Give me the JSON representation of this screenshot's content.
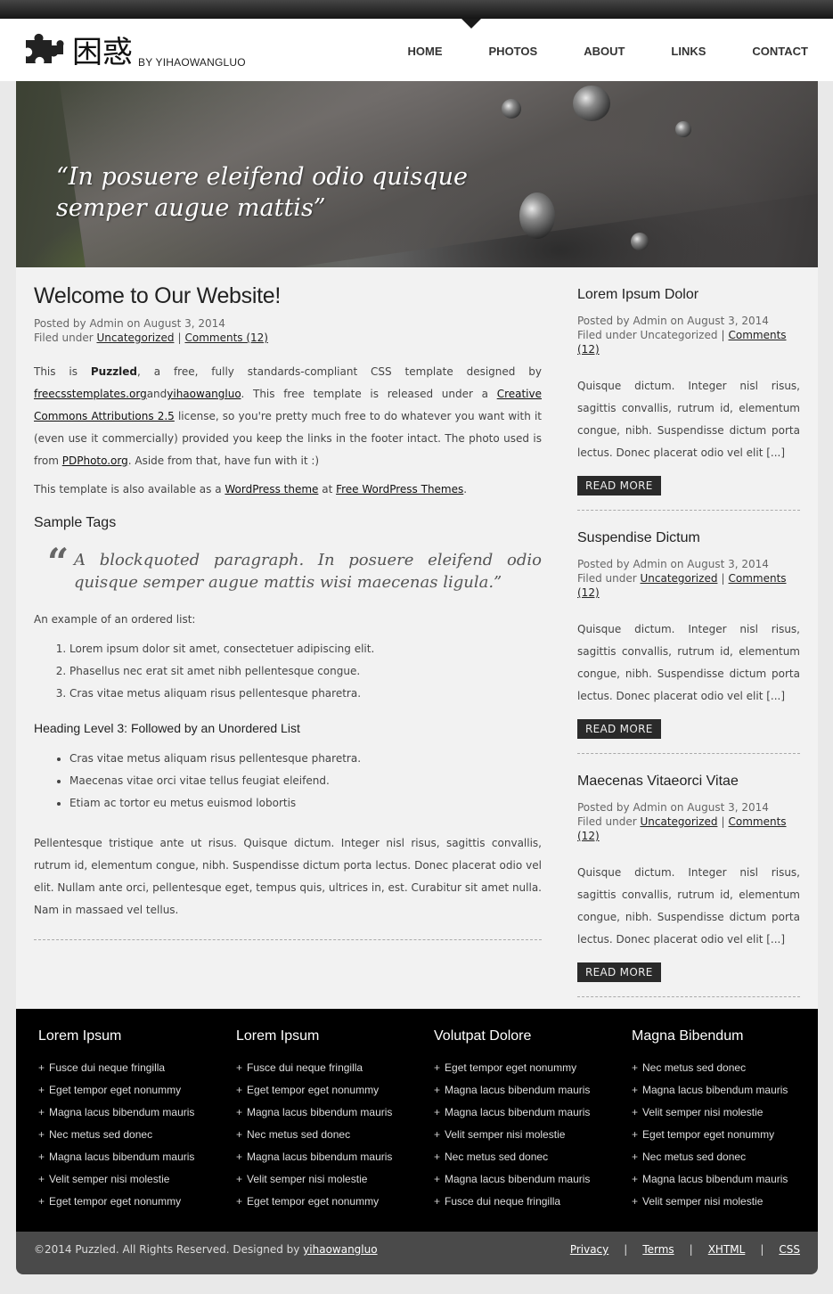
{
  "header": {
    "logo_title": "困惑",
    "logo_by": "BY YIHAOWANGLUO",
    "nav": [
      "HOME",
      "PHOTOS",
      "ABOUT",
      "LINKS",
      "CONTACT"
    ]
  },
  "hero": {
    "quote_line1": "“In posuere eleifend odio quisque",
    "quote_line2": "semper augue mattis”"
  },
  "main": {
    "title": "Welcome to Our Website!",
    "posted": "Posted by Admin on August 3, 2014",
    "filed_prefix": "Filed under ",
    "category": "Uncategorized",
    "comments": "Comments (12)",
    "intro": {
      "t1": "This is ",
      "puzzled": "Puzzled",
      "t2": ", a free, fully standards-compliant CSS template designed by ",
      "link1": "freecsstemplates.org",
      "and": "and",
      "link2": "yihaowangluo",
      "t3": ". This free template is released under a ",
      "link3": "Creative Commons Attributions 2.5",
      "t4": " license, so you're pretty much free to do whatever you want with it (even use it commercially) provided you keep the links in the footer intact. The photo used is from ",
      "link4": "PDPhoto.org",
      "t5": ". Aside from that, have fun with it :)"
    },
    "p2": {
      "t1": "This template is also available as a ",
      "link1": "WordPress theme",
      "t2": " at ",
      "link2": "Free WordPress Themes",
      "t3": "."
    },
    "sample_tags": "Sample Tags",
    "blockquote": "A blockquoted paragraph. In posuere eleifend odio quisque semper augue mattis wisi maecenas ligula.”",
    "ol_intro": "An example of an ordered list:",
    "ol": [
      "Lorem ipsum dolor sit amet, consectetuer adipiscing elit.",
      "Phasellus nec erat sit amet nibh pellentesque congue.",
      "Cras vitae metus aliquam risus pellentesque pharetra."
    ],
    "h3": "Heading Level 3: Followed by an Unordered List",
    "ul": [
      "Cras vitae metus aliquam risus pellentesque pharetra.",
      "Maecenas vitae orci vitae tellus feugiat eleifend.",
      "Etiam ac tortor eu metus euismod lobortis"
    ],
    "last": "Pellentesque tristique ante ut risus. Quisque dictum. Integer nisl risus, sagittis convallis, rutrum id, elementum congue, nibh. Suspendisse dictum porta lectus. Donec placerat odio vel elit. Nullam ante orci, pellentesque eget, tempus quis, ultrices in, est. Curabitur sit amet nulla. Nam in massaed vel tellus."
  },
  "sidebar": {
    "posts": [
      {
        "title": "Lorem Ipsum Dolor",
        "posted": "Posted by Admin on August 3, 2014",
        "filed_prefix": "Filed under ",
        "category": "Uncategorized",
        "comments": "Comments (12)",
        "excerpt": "Quisque dictum. Integer nisl risus, sagittis convallis, rutrum id, elementum congue, nibh. Suspendisse dictum porta lectus. Donec placerat odio vel elit [...]",
        "read_more": "READ MORE"
      },
      {
        "title": "Suspendise Dictum",
        "posted": "Posted by Admin on August 3, 2014",
        "filed_prefix": "Filed under ",
        "category": "Uncategorized",
        "comments": "Comments (12)",
        "excerpt": "Quisque dictum. Integer nisl risus, sagittis convallis, rutrum id, elementum congue, nibh. Suspendisse dictum porta lectus. Donec placerat odio vel elit [...]",
        "read_more": "READ MORE"
      },
      {
        "title": "Maecenas Vitaeorci Vitae",
        "posted": "Posted by Admin on August 3, 2014",
        "filed_prefix": "Filed under ",
        "category": "Uncategorized",
        "comments": "Comments (12)",
        "excerpt": "Quisque dictum. Integer nisl risus, sagittis convallis, rutrum id, elementum congue, nibh. Suspendisse dictum porta lectus. Donec placerat odio vel elit [...]",
        "read_more": "READ MORE"
      }
    ]
  },
  "footer": {
    "columns": [
      {
        "title": "Lorem Ipsum",
        "items": [
          "Fusce dui neque fringilla",
          "Eget tempor eget nonummy",
          "Magna lacus bibendum mauris",
          "Nec metus sed donec",
          "Magna lacus bibendum mauris",
          "Velit semper nisi molestie",
          "Eget tempor eget nonummy"
        ]
      },
      {
        "title": "Lorem Ipsum",
        "items": [
          "Fusce dui neque fringilla",
          "Eget tempor eget nonummy",
          "Magna lacus bibendum mauris",
          "Nec metus sed donec",
          "Magna lacus bibendum mauris",
          "Velit semper nisi molestie",
          "Eget tempor eget nonummy"
        ]
      },
      {
        "title": "Volutpat Dolore",
        "items": [
          "Eget tempor eget nonummy",
          "Magna lacus bibendum mauris",
          "Magna lacus bibendum mauris",
          "Velit semper nisi molestie",
          "Nec metus sed donec",
          "Magna lacus bibendum mauris",
          "Fusce dui neque fringilla"
        ]
      },
      {
        "title": "Magna Bibendum",
        "items": [
          "Nec metus sed donec",
          "Magna lacus bibendum mauris",
          "Velit semper nisi molestie",
          "Eget tempor eget nonummy",
          "Nec metus sed donec",
          "Magna lacus bibendum mauris",
          "Velit semper nisi molestie"
        ]
      }
    ],
    "copyright": "©2014 Puzzled. All Rights Reserved. Designed by ",
    "designer": "yihaowangluo",
    "links": [
      "Privacy",
      "Terms",
      "XHTML",
      "CSS"
    ],
    "separator": "|"
  }
}
